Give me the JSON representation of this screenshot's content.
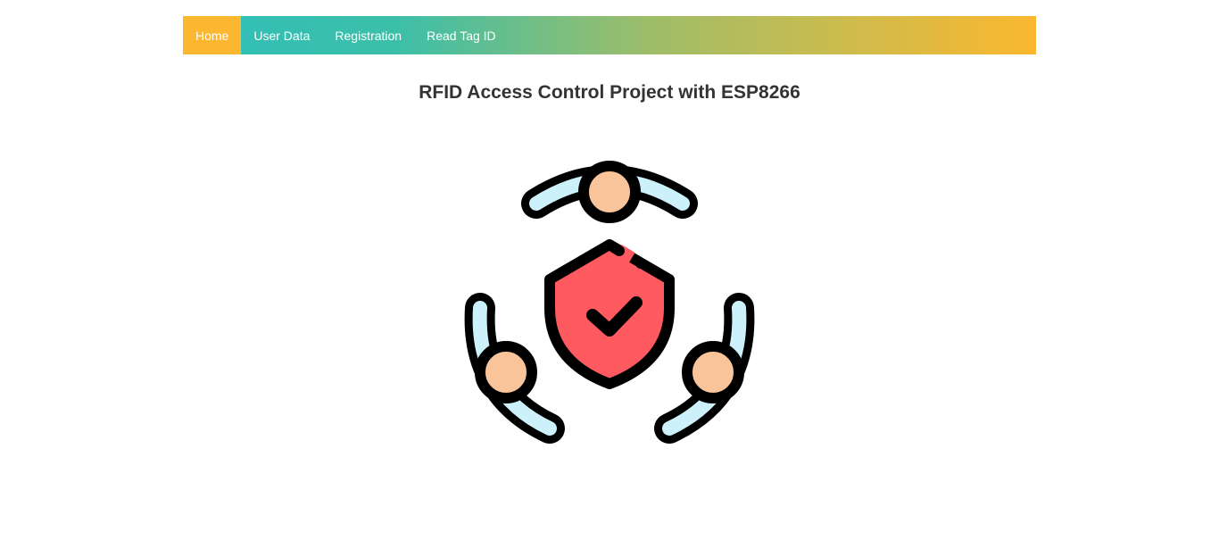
{
  "nav": {
    "items": [
      {
        "label": "Home",
        "active": true
      },
      {
        "label": "User Data",
        "active": false
      },
      {
        "label": "Registration",
        "active": false
      },
      {
        "label": "Read Tag ID",
        "active": false
      }
    ],
    "active_color": "#fbb72f",
    "gradient_colors": [
      "#2fbfb8",
      "#3cbfa9",
      "#9fbd68",
      "#d2bb4a",
      "#fbb72f"
    ]
  },
  "main": {
    "title": "RFID Access Control Project with ESP8266",
    "illustration_icon": "shield-check-people-icon"
  },
  "colors": {
    "shield": "#ff5a5f",
    "skin": "#f9c499",
    "arm": "#cdf1fb",
    "outline": "#000000",
    "title_text": "#333333"
  }
}
